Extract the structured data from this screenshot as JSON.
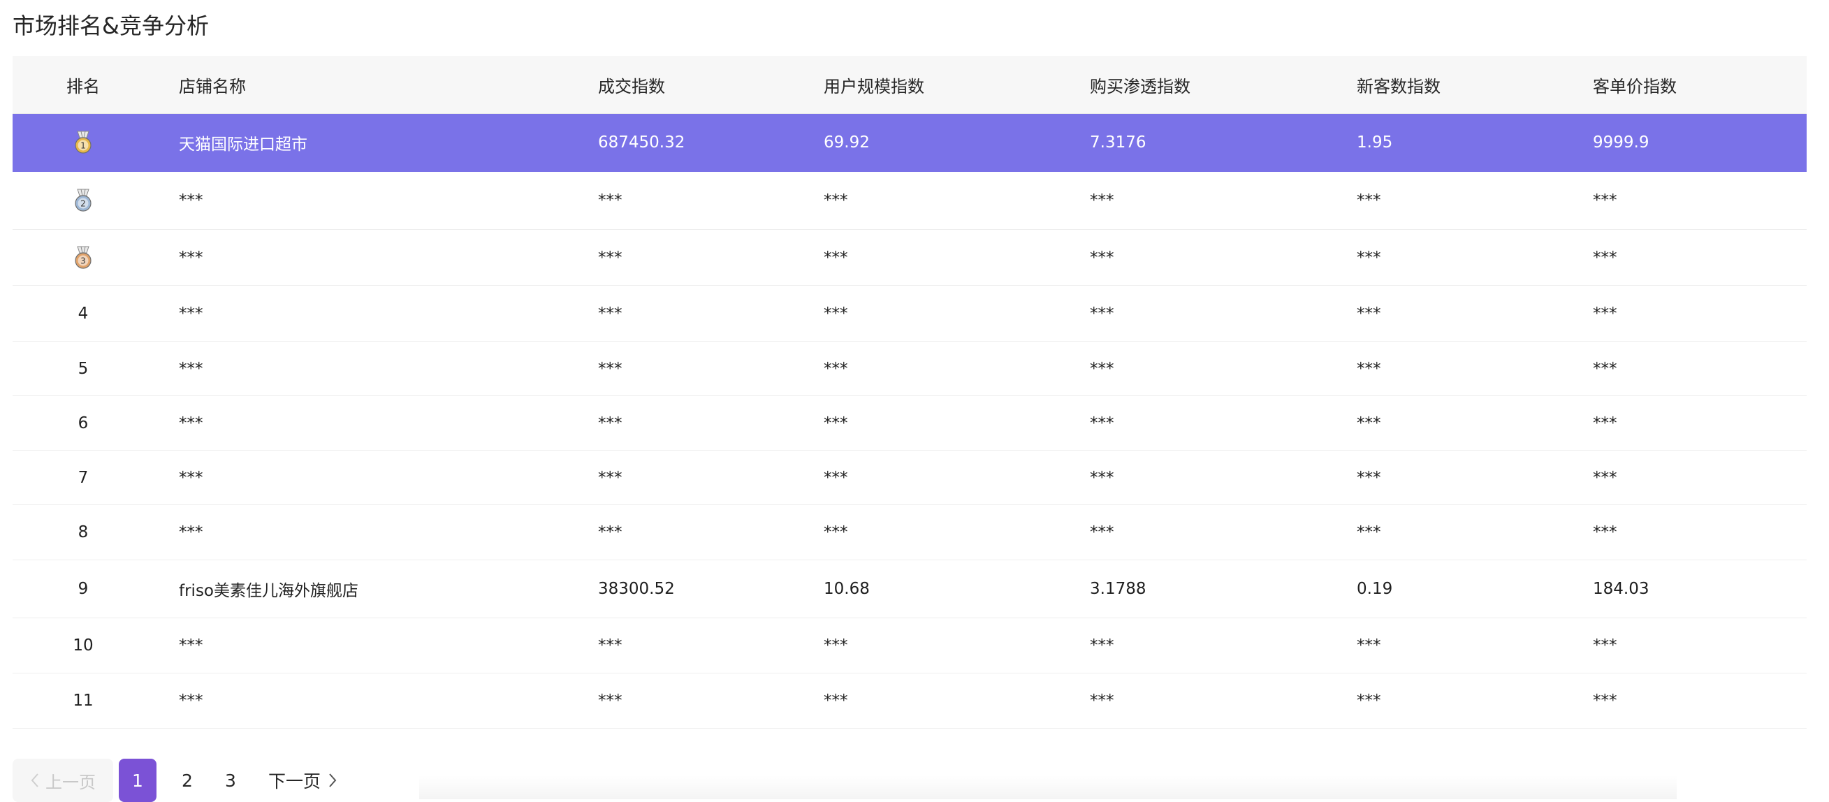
{
  "page": {
    "title": "市场排名&竞争分析"
  },
  "table": {
    "headers": {
      "rank": "排名",
      "store_name": "店铺名称",
      "deal_index": "成交指数",
      "user_scale_index": "用户规模指数",
      "penetration_index": "购买渗透指数",
      "new_customer_index": "新客数指数",
      "unit_price_index": "客单价指数"
    },
    "rows": [
      {
        "rank": "1",
        "medal": "gold-medal-icon",
        "store_name": "天猫国际进口超市",
        "deal_index": "687450.32",
        "user_scale_index": "69.92",
        "penetration_index": "7.3176",
        "new_customer_index": "1.95",
        "unit_price_index": "9999.9",
        "highlighted": true
      },
      {
        "rank": "2",
        "medal": "silver-medal-icon",
        "store_name": "***",
        "deal_index": "***",
        "user_scale_index": "***",
        "penetration_index": "***",
        "new_customer_index": "***",
        "unit_price_index": "***"
      },
      {
        "rank": "3",
        "medal": "bronze-medal-icon",
        "store_name": "***",
        "deal_index": "***",
        "user_scale_index": "***",
        "penetration_index": "***",
        "new_customer_index": "***",
        "unit_price_index": "***"
      },
      {
        "rank": "4",
        "store_name": "***",
        "deal_index": "***",
        "user_scale_index": "***",
        "penetration_index": "***",
        "new_customer_index": "***",
        "unit_price_index": "***"
      },
      {
        "rank": "5",
        "store_name": "***",
        "deal_index": "***",
        "user_scale_index": "***",
        "penetration_index": "***",
        "new_customer_index": "***",
        "unit_price_index": "***"
      },
      {
        "rank": "6",
        "store_name": "***",
        "deal_index": "***",
        "user_scale_index": "***",
        "penetration_index": "***",
        "new_customer_index": "***",
        "unit_price_index": "***"
      },
      {
        "rank": "7",
        "store_name": "***",
        "deal_index": "***",
        "user_scale_index": "***",
        "penetration_index": "***",
        "new_customer_index": "***",
        "unit_price_index": "***"
      },
      {
        "rank": "8",
        "store_name": "***",
        "deal_index": "***",
        "user_scale_index": "***",
        "penetration_index": "***",
        "new_customer_index": "***",
        "unit_price_index": "***"
      },
      {
        "rank": "9",
        "store_name": "friso美素佳儿海外旗舰店",
        "deal_index": "38300.52",
        "user_scale_index": "10.68",
        "penetration_index": "3.1788",
        "new_customer_index": "0.19",
        "unit_price_index": "184.03"
      },
      {
        "rank": "10",
        "store_name": "***",
        "deal_index": "***",
        "user_scale_index": "***",
        "penetration_index": "***",
        "new_customer_index": "***",
        "unit_price_index": "***"
      },
      {
        "rank": "11",
        "store_name": "***",
        "deal_index": "***",
        "user_scale_index": "***",
        "penetration_index": "***",
        "new_customer_index": "***",
        "unit_price_index": "***"
      }
    ]
  },
  "pagination": {
    "prev_label": "上一页",
    "pages": [
      "1",
      "2",
      "3"
    ],
    "current_page": "1",
    "next_label": "下一页"
  },
  "colors": {
    "highlight_row": "#7a72e8",
    "active_page": "#7b52d6",
    "header_bg": "#f7f7f7",
    "gold_medal": "#e8b84a",
    "silver_medal": "#9db7d6",
    "bronze_medal": "#e0a26a"
  }
}
